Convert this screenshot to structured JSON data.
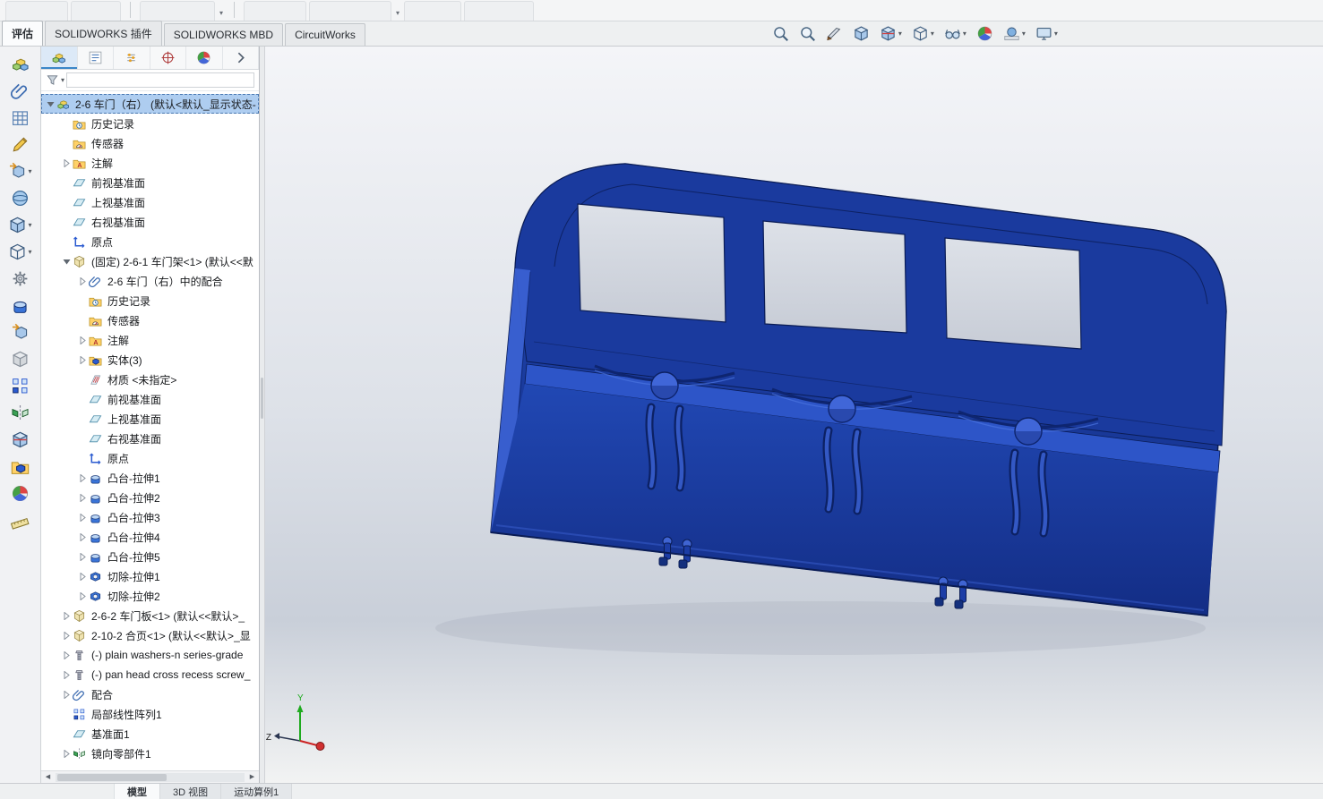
{
  "command_tabs": [
    {
      "label": "评估",
      "active": true
    },
    {
      "label": "SOLIDWORKS 插件",
      "active": false
    },
    {
      "label": "SOLIDWORKS MBD",
      "active": false
    },
    {
      "label": "CircuitWorks",
      "active": false
    }
  ],
  "headsup_toolbar": [
    {
      "icon": "zoom-fit-icon",
      "glyph": "magnifier-fit",
      "caret": false
    },
    {
      "icon": "zoom-area-icon",
      "glyph": "magnifier-area",
      "caret": false
    },
    {
      "icon": "section-view-icon",
      "glyph": "knife",
      "caret": false
    },
    {
      "icon": "view-orientation-icon",
      "glyph": "cube",
      "caret": false
    },
    {
      "icon": "section-cube-icon",
      "glyph": "cube-section",
      "caret": true
    },
    {
      "icon": "display-style-icon",
      "glyph": "wirecube",
      "caret": true
    },
    {
      "icon": "hide-show-items-icon",
      "glyph": "glasses",
      "caret": true
    },
    {
      "icon": "edit-appearance-icon",
      "glyph": "ball",
      "caret": false
    },
    {
      "icon": "apply-scene-icon",
      "glyph": "scene",
      "caret": true
    },
    {
      "icon": "view-settings-icon",
      "glyph": "monitor",
      "caret": true
    }
  ],
  "left_toolbar": [
    {
      "icon": "assembly-visualization-icon",
      "glyph": "assembly",
      "caret": false
    },
    {
      "icon": "attachments-icon",
      "glyph": "clip",
      "caret": false
    },
    {
      "icon": "pattern-table-icon",
      "glyph": "grid",
      "caret": false
    },
    {
      "icon": "edit-sketch-icon",
      "glyph": "pencil",
      "caret": false
    },
    {
      "icon": "derived-component-icon",
      "glyph": "arrowcube",
      "caret": true
    },
    {
      "icon": "smart-component-icon",
      "glyph": "sphere",
      "caret": false
    },
    {
      "icon": "move-component-icon",
      "glyph": "cube",
      "caret": true
    },
    {
      "icon": "show-hidden-components-icon",
      "glyph": "wirecube",
      "caret": true
    },
    {
      "icon": "exploded-view-icon",
      "glyph": "gear",
      "caret": false
    },
    {
      "icon": "solid-component-icon",
      "glyph": "boss",
      "caret": false
    },
    {
      "icon": "insert-component-icon",
      "glyph": "arrowcube",
      "caret": false
    },
    {
      "icon": "ghost-component-icon",
      "glyph": "graycube",
      "caret": false
    },
    {
      "icon": "interference-detection-icon",
      "glyph": "pattern",
      "caret": false
    },
    {
      "icon": "clearance-verification-icon",
      "glyph": "mirror",
      "caret": false
    },
    {
      "icon": "hole-alignment-icon",
      "glyph": "cube-section",
      "caret": false
    },
    {
      "icon": "component-stack-icon",
      "glyph": "folder-solid",
      "caret": false
    },
    {
      "icon": "appearances-icon",
      "glyph": "ball",
      "caret": false
    },
    {
      "icon": "measure-icon",
      "glyph": "ruler",
      "caret": false
    }
  ],
  "tree_panel": {
    "tabs": [
      {
        "icon": "featuremanager-tab-icon",
        "glyph": "assembly",
        "active": true
      },
      {
        "icon": "propertymanager-tab-icon",
        "glyph": "list",
        "active": false
      },
      {
        "icon": "configurationmanager-tab-icon",
        "glyph": "config",
        "active": false
      },
      {
        "icon": "dimxpertmanager-tab-icon",
        "glyph": "target",
        "active": false
      },
      {
        "icon": "displaymanager-tab-icon",
        "glyph": "ball",
        "active": false
      },
      {
        "icon": "panel-flyout-icon",
        "glyph": "chev-right",
        "active": false
      }
    ],
    "filter": {
      "icon": "filter-funnel-icon",
      "glyph": "funnel",
      "value": ""
    },
    "items": [
      {
        "indent": 0,
        "arrow": "down",
        "icon": "assembly-icon",
        "glyph": "assembly",
        "label": "2-6 车门（右） (默认<默认_显示状态-",
        "selected": true
      },
      {
        "indent": 1,
        "arrow": null,
        "icon": "history-folder-icon",
        "glyph": "folder-clock",
        "label": "历史记录",
        "selected": false
      },
      {
        "indent": 1,
        "arrow": null,
        "icon": "sensors-folder-icon",
        "glyph": "folder-gauge",
        "label": "传感器",
        "selected": false
      },
      {
        "indent": 1,
        "arrow": "right",
        "icon": "annotations-folder-icon",
        "glyph": "folder-a",
        "label": "注解",
        "selected": false
      },
      {
        "indent": 1,
        "arrow": null,
        "icon": "plane-icon",
        "glyph": "plane",
        "label": "前视基准面",
        "selected": false
      },
      {
        "indent": 1,
        "arrow": null,
        "icon": "plane-icon",
        "glyph": "plane",
        "label": "上视基准面",
        "selected": false
      },
      {
        "indent": 1,
        "arrow": null,
        "icon": "plane-icon",
        "glyph": "plane",
        "label": "右视基准面",
        "selected": false
      },
      {
        "indent": 1,
        "arrow": null,
        "icon": "origin-icon",
        "glyph": "origin",
        "label": "原点",
        "selected": false
      },
      {
        "indent": 1,
        "arrow": "down",
        "icon": "part-icon",
        "glyph": "part",
        "label": "(固定) 2-6-1 车门架<1> (默认<<默",
        "selected": false
      },
      {
        "indent": 2,
        "arrow": "right",
        "icon": "mates-group-icon",
        "glyph": "clip",
        "label": "2-6 车门（右）中的配合",
        "selected": false
      },
      {
        "indent": 2,
        "arrow": null,
        "icon": "history-folder-icon",
        "glyph": "folder-clock",
        "label": "历史记录",
        "selected": false
      },
      {
        "indent": 2,
        "arrow": null,
        "icon": "sensors-folder-icon",
        "glyph": "folder-gauge",
        "label": "传感器",
        "selected": false
      },
      {
        "indent": 2,
        "arrow": "right",
        "icon": "annotations-folder-icon",
        "glyph": "folder-a",
        "label": "注解",
        "selected": false
      },
      {
        "indent": 2,
        "arrow": "right",
        "icon": "solid-bodies-folder-icon",
        "glyph": "folder-solid",
        "label": "实体(3)",
        "selected": false
      },
      {
        "indent": 2,
        "arrow": null,
        "icon": "material-icon",
        "glyph": "material",
        "label": "材质 <未指定>",
        "selected": false
      },
      {
        "indent": 2,
        "arrow": null,
        "icon": "plane-icon",
        "glyph": "plane",
        "label": "前视基准面",
        "selected": false
      },
      {
        "indent": 2,
        "arrow": null,
        "icon": "plane-icon",
        "glyph": "plane",
        "label": "上视基准面",
        "selected": false
      },
      {
        "indent": 2,
        "arrow": null,
        "icon": "plane-icon",
        "glyph": "plane",
        "label": "右视基准面",
        "selected": false
      },
      {
        "indent": 2,
        "arrow": null,
        "icon": "origin-icon",
        "glyph": "origin",
        "label": "原点",
        "selected": false
      },
      {
        "indent": 2,
        "arrow": "right",
        "icon": "boss-extrude-icon",
        "glyph": "boss",
        "label": "凸台-拉伸1",
        "selected": false
      },
      {
        "indent": 2,
        "arrow": "right",
        "icon": "boss-extrude-icon",
        "glyph": "boss",
        "label": "凸台-拉伸2",
        "selected": false
      },
      {
        "indent": 2,
        "arrow": "right",
        "icon": "boss-extrude-icon",
        "glyph": "boss",
        "label": "凸台-拉伸3",
        "selected": false
      },
      {
        "indent": 2,
        "arrow": "right",
        "icon": "boss-extrude-icon",
        "glyph": "boss",
        "label": "凸台-拉伸4",
        "selected": false
      },
      {
        "indent": 2,
        "arrow": "right",
        "icon": "boss-extrude-icon",
        "glyph": "boss",
        "label": "凸台-拉伸5",
        "selected": false
      },
      {
        "indent": 2,
        "arrow": "right",
        "icon": "cut-extrude-icon",
        "glyph": "cut",
        "label": "切除-拉伸1",
        "selected": false
      },
      {
        "indent": 2,
        "arrow": "right",
        "icon": "cut-extrude-icon",
        "glyph": "cut",
        "label": "切除-拉伸2",
        "selected": false
      },
      {
        "indent": 1,
        "arrow": "right",
        "icon": "part-icon",
        "glyph": "part",
        "label": "2-6-2 车门板<1> (默认<<默认>_",
        "selected": false
      },
      {
        "indent": 1,
        "arrow": "right",
        "icon": "part-icon",
        "glyph": "part",
        "label": "2-10-2 合页<1> (默认<<默认>_显",
        "selected": false
      },
      {
        "indent": 1,
        "arrow": "right",
        "icon": "fastener-icon",
        "glyph": "screw",
        "label": "(-) plain washers-n series-grade",
        "selected": false
      },
      {
        "indent": 1,
        "arrow": "right",
        "icon": "fastener-icon",
        "glyph": "screw",
        "label": "(-) pan head cross recess screw_",
        "selected": false
      },
      {
        "indent": 1,
        "arrow": "right",
        "icon": "mates-group-icon",
        "glyph": "clip",
        "label": "配合",
        "selected": false
      },
      {
        "indent": 1,
        "arrow": null,
        "icon": "linear-pattern-icon",
        "glyph": "pattern",
        "label": "局部线性阵列1",
        "selected": false
      },
      {
        "indent": 1,
        "arrow": null,
        "icon": "plane-feature-icon",
        "glyph": "plane",
        "label": "基准面1",
        "selected": false
      },
      {
        "indent": 1,
        "arrow": "right",
        "icon": "mirror-component-icon",
        "glyph": "mirror",
        "label": "镜向零部件1",
        "selected": false
      }
    ]
  },
  "viewport": {
    "triad": {
      "y_label": "Y",
      "z_label": "Z"
    },
    "colors": {
      "model_blue": "#1e42b0",
      "model_dark_edge": "#0a1c55",
      "model_highlight": "#4a74e0",
      "background_top": "#f4f5f8",
      "background_mid": "#c9cfd9",
      "selection_highlight": "#aecdf0"
    }
  },
  "status_bar": {
    "tabs": [
      {
        "label": "模型",
        "active": true
      },
      {
        "label": "3D 视图",
        "active": false
      },
      {
        "label": "运动算例1",
        "active": false
      }
    ]
  }
}
